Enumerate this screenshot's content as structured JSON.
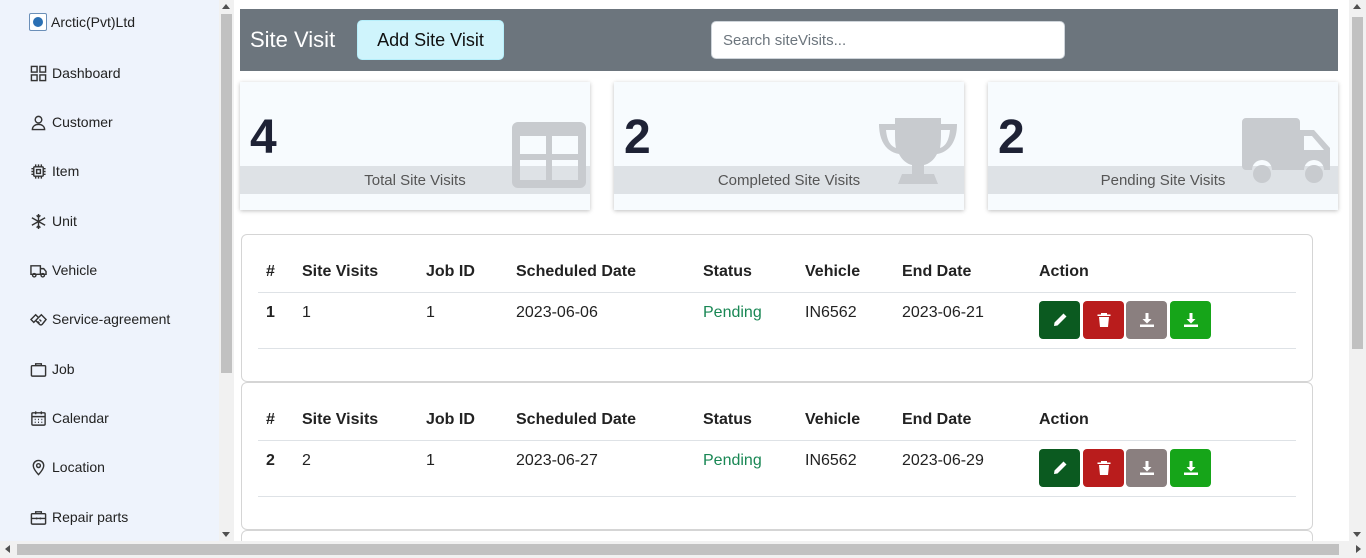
{
  "brand": {
    "name": "Arctic(Pvt)Ltd"
  },
  "sidebar": {
    "items": [
      {
        "label": "Dashboard",
        "icon": "dashboard-icon"
      },
      {
        "label": "Customer",
        "icon": "person-icon"
      },
      {
        "label": "Item",
        "icon": "chip-icon"
      },
      {
        "label": "Unit",
        "icon": "snowflake-icon"
      },
      {
        "label": "Vehicle",
        "icon": "truck-icon"
      },
      {
        "label": "Service-agreement",
        "icon": "handshake-icon"
      },
      {
        "label": "Job",
        "icon": "briefcase-icon"
      },
      {
        "label": "Calendar",
        "icon": "calendar-icon"
      },
      {
        "label": "Location",
        "icon": "location-pin-icon"
      },
      {
        "label": "Repair parts",
        "icon": "toolbox-icon"
      }
    ]
  },
  "header": {
    "title": "Site Visit",
    "add_button": "Add Site Visit",
    "search_placeholder": "Search siteVisits..."
  },
  "stats": [
    {
      "value": "4",
      "label": "Total Site Visits",
      "icon": "table-icon"
    },
    {
      "value": "2",
      "label": "Completed Site Visits",
      "icon": "trophy-icon"
    },
    {
      "value": "2",
      "label": "Pending Site Visits",
      "icon": "truck-icon"
    }
  ],
  "table": {
    "headers": [
      "#",
      "Site Visits",
      "Job ID",
      "Scheduled Date",
      "Status",
      "Vehicle",
      "End Date",
      "Action"
    ],
    "rows": [
      {
        "index": "1",
        "site_visit": "1",
        "job_id": "1",
        "scheduled_date": "2023-06-06",
        "status": "Pending",
        "vehicle": "IN6562",
        "end_date": "2023-06-21"
      },
      {
        "index": "2",
        "site_visit": "2",
        "job_id": "1",
        "scheduled_date": "2023-06-27",
        "status": "Pending",
        "vehicle": "IN6562",
        "end_date": "2023-06-29"
      }
    ],
    "actions": [
      {
        "name": "edit-button",
        "icon": "pencil-icon",
        "color": "#0b5a20"
      },
      {
        "name": "delete-button",
        "icon": "trash-icon",
        "color": "#b91c1c"
      },
      {
        "name": "download-button",
        "icon": "download-icon",
        "color": "#8a7f7f"
      },
      {
        "name": "export-button",
        "icon": "download-icon",
        "color": "#16a519"
      }
    ]
  },
  "colors": {
    "header_bg": "#6c757d",
    "sidebar_bg": "#eef3fc",
    "add_button_bg": "#cff4fc",
    "status_pending": "#198754"
  }
}
